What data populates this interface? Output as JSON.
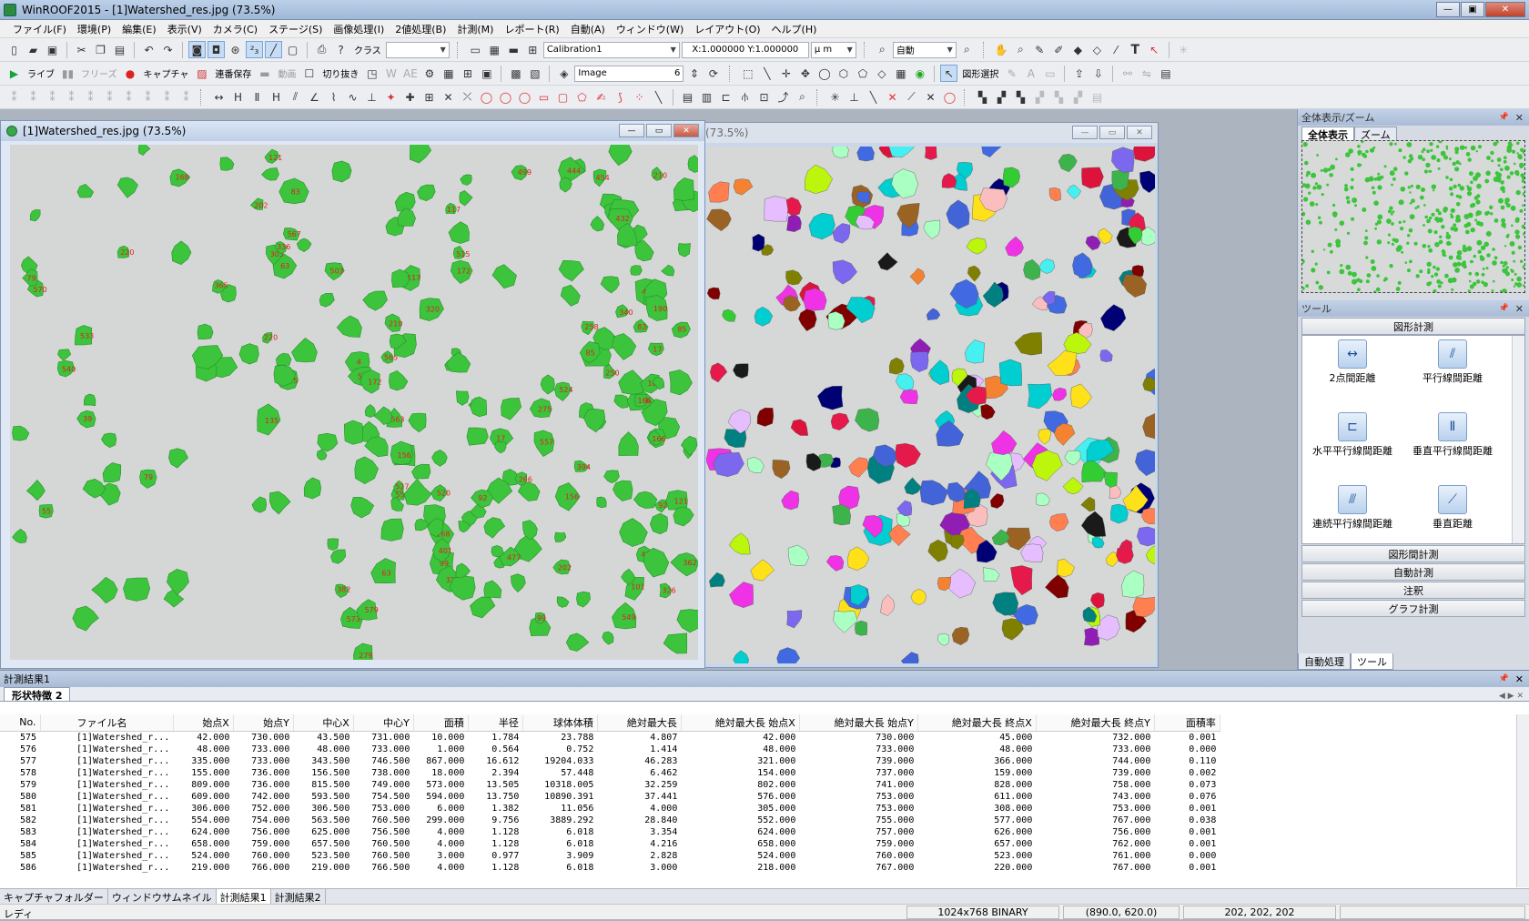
{
  "app": {
    "title": "WinROOF2015 - [1]Watershed_res.jpg (73.5%)",
    "min": "—",
    "max": "▣",
    "close": "✕"
  },
  "menu": [
    "ファイル(F)",
    "環境(P)",
    "編集(E)",
    "表示(V)",
    "カメラ(C)",
    "ステージ(S)",
    "画像処理(I)",
    "2値処理(B)",
    "計測(M)",
    "レポート(R)",
    "自動(A)",
    "ウィンドウ(W)",
    "レイアウト(O)",
    "ヘルプ(H)"
  ],
  "toolbar1": {
    "class_label": "クラス",
    "class_value": "",
    "calibration": "Calibration1",
    "scale_xy": "X:1.000000 Y:1.000000",
    "unit": "μ m",
    "zoom_mode": "自動"
  },
  "toolbar2": {
    "live": "ライブ",
    "freeze": "フリーズ",
    "capture": "キャプチャ",
    "continuous_save": "連番保存",
    "movie": "動画",
    "crop": "切り抜き",
    "image_source": "Image",
    "image_index": "6",
    "shape_select": "図形選択"
  },
  "windows": {
    "main_title": "[1]Watershed_res.jpg (73.5%)",
    "second_title": "(73.5%)"
  },
  "image_labels": [
    "4",
    "17",
    "39",
    "55",
    "63",
    "79",
    "83",
    "85",
    "92",
    "99",
    "101",
    "117",
    "121",
    "135",
    "156",
    "166",
    "168",
    "172",
    "190",
    "202",
    "210",
    "220",
    "250",
    "258",
    "266",
    "275",
    "279",
    "291",
    "305",
    "320",
    "322",
    "326",
    "336",
    "340",
    "362",
    "365",
    "382",
    "394",
    "401",
    "412",
    "416",
    "432",
    "444",
    "454",
    "477",
    "490",
    "499",
    "503",
    "515",
    "520",
    "524",
    "527",
    "533",
    "540",
    "549",
    "557",
    "563",
    "565",
    "567",
    "570",
    "573",
    "579",
    "583"
  ],
  "overview_panel": {
    "title": "全体表示/ズーム",
    "tab_overview": "全体表示",
    "tab_zoom": "ズーム"
  },
  "tools_panel": {
    "title": "ツール",
    "section_shape": "図形計測",
    "tools": [
      {
        "label": "2点間距離",
        "icon": "two-point-distance-icon"
      },
      {
        "label": "平行線間距離",
        "icon": "parallel-line-distance-icon"
      },
      {
        "label": "水平平行線間距離",
        "icon": "horizontal-parallel-distance-icon"
      },
      {
        "label": "垂直平行線間距離",
        "icon": "vertical-parallel-distance-icon"
      },
      {
        "label": "連続平行線間距離",
        "icon": "continuous-parallel-distance-icon"
      },
      {
        "label": "垂直距離",
        "icon": "perpendicular-distance-icon"
      }
    ],
    "sections": [
      "図形間計測",
      "自動計測",
      "注釈",
      "グラフ計測"
    ],
    "bottom_tabs": [
      "自動処理",
      "ツール"
    ]
  },
  "results": {
    "title": "計測結果1",
    "tab": "形状特徴 2",
    "columns": [
      "No.",
      "ファイル名",
      "始点X",
      "始点Y",
      "中心X",
      "中心Y",
      "面積",
      "半径",
      "球体体積",
      "絶対最大長",
      "絶対最大長 始点X",
      "絶対最大長 始点Y",
      "絶対最大長 終点X",
      "絶対最大長 終点Y",
      "面積率"
    ],
    "rows": [
      [
        "575",
        "[1]Watershed_r...",
        "42.000",
        "730.000",
        "43.500",
        "731.000",
        "10.000",
        "1.784",
        "23.788",
        "4.807",
        "42.000",
        "730.000",
        "45.000",
        "732.000",
        "0.001"
      ],
      [
        "576",
        "[1]Watershed_r...",
        "48.000",
        "733.000",
        "48.000",
        "733.000",
        "1.000",
        "0.564",
        "0.752",
        "1.414",
        "48.000",
        "733.000",
        "48.000",
        "733.000",
        "0.000"
      ],
      [
        "577",
        "[1]Watershed_r...",
        "335.000",
        "733.000",
        "343.500",
        "746.500",
        "867.000",
        "16.612",
        "19204.033",
        "46.283",
        "321.000",
        "739.000",
        "366.000",
        "744.000",
        "0.110"
      ],
      [
        "578",
        "[1]Watershed_r...",
        "155.000",
        "736.000",
        "156.500",
        "738.000",
        "18.000",
        "2.394",
        "57.448",
        "6.462",
        "154.000",
        "737.000",
        "159.000",
        "739.000",
        "0.002"
      ],
      [
        "579",
        "[1]Watershed_r...",
        "809.000",
        "736.000",
        "815.500",
        "749.000",
        "573.000",
        "13.505",
        "10318.005",
        "32.259",
        "802.000",
        "741.000",
        "828.000",
        "758.000",
        "0.073"
      ],
      [
        "580",
        "[1]Watershed_r...",
        "609.000",
        "742.000",
        "593.500",
        "754.500",
        "594.000",
        "13.750",
        "10890.391",
        "37.441",
        "576.000",
        "753.000",
        "611.000",
        "743.000",
        "0.076"
      ],
      [
        "581",
        "[1]Watershed_r...",
        "306.000",
        "752.000",
        "306.500",
        "753.000",
        "6.000",
        "1.382",
        "11.056",
        "4.000",
        "305.000",
        "753.000",
        "308.000",
        "753.000",
        "0.001"
      ],
      [
        "582",
        "[1]Watershed_r...",
        "554.000",
        "754.000",
        "563.500",
        "760.500",
        "299.000",
        "9.756",
        "3889.292",
        "28.840",
        "552.000",
        "755.000",
        "577.000",
        "767.000",
        "0.038"
      ],
      [
        "583",
        "[1]Watershed_r...",
        "624.000",
        "756.000",
        "625.000",
        "756.500",
        "4.000",
        "1.128",
        "6.018",
        "3.354",
        "624.000",
        "757.000",
        "626.000",
        "756.000",
        "0.001"
      ],
      [
        "584",
        "[1]Watershed_r...",
        "658.000",
        "759.000",
        "657.500",
        "760.500",
        "4.000",
        "1.128",
        "6.018",
        "4.216",
        "658.000",
        "759.000",
        "657.000",
        "762.000",
        "0.001"
      ],
      [
        "585",
        "[1]Watershed_r...",
        "524.000",
        "760.000",
        "523.500",
        "760.500",
        "3.000",
        "0.977",
        "3.909",
        "2.828",
        "524.000",
        "760.000",
        "523.000",
        "761.000",
        "0.000"
      ],
      [
        "586",
        "[1]Watershed_r...",
        "219.000",
        "766.000",
        "219.000",
        "766.500",
        "4.000",
        "1.128",
        "6.018",
        "3.000",
        "218.000",
        "767.000",
        "220.000",
        "767.000",
        "0.001"
      ]
    ]
  },
  "bottom_tabs": [
    "キャプチャフォルダー",
    "ウィンドウサムネイル",
    "計測結果1",
    "計測結果2"
  ],
  "status": {
    "ready": "レディ",
    "image_info": "1024x768 BINARY",
    "cursor_pos": "(890.0, 620.0)",
    "pixel_value": "202, 202, 202"
  },
  "colors": {
    "particle_green": "#3cc43c",
    "label_red": "#e02020",
    "background_gray": "#d4d7d5"
  }
}
